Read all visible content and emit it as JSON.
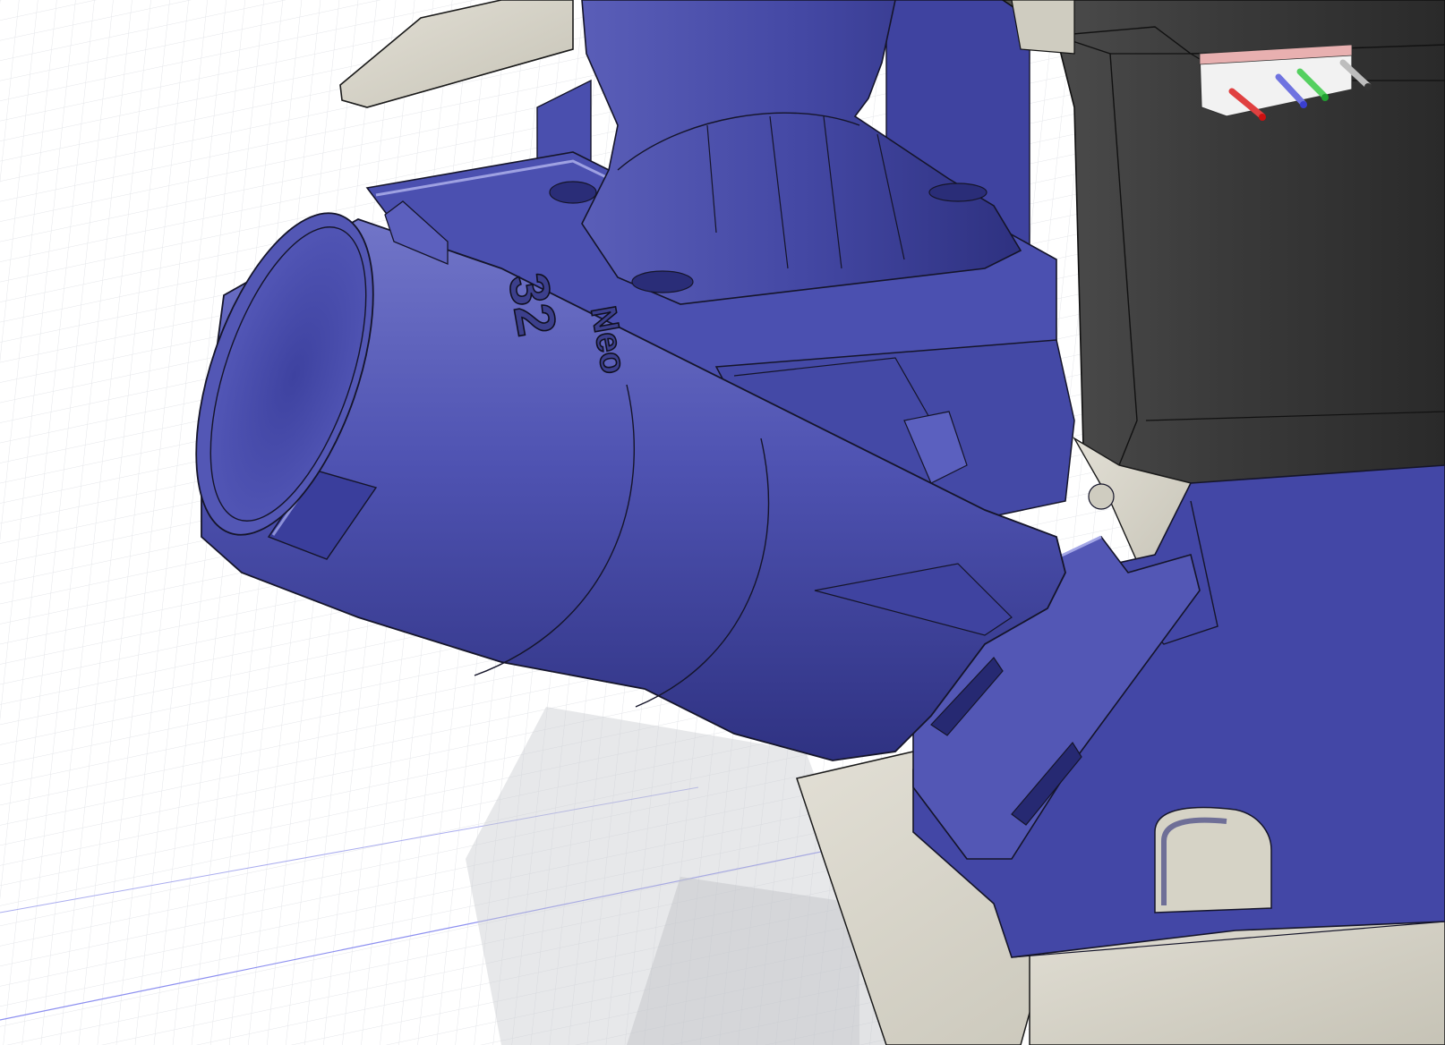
{
  "viewport": {
    "part_engraving_number": "32",
    "part_engraving_text": "Neo"
  },
  "colors": {
    "part_blue": "#4a4fae",
    "part_blue_light": "#6c70c4",
    "part_blue_dark": "#2f3282",
    "plate_beige": "#d7d4c8",
    "motor_black": "#3a3a3a",
    "grid_line": "#dadde2",
    "background": "#ffffff",
    "axis_blue": "#8c8ff0"
  }
}
